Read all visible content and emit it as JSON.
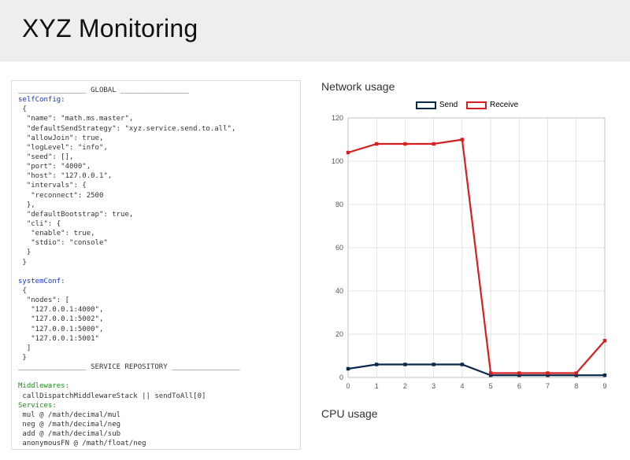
{
  "header": {
    "title": "XYZ Monitoring"
  },
  "config_panel": {
    "global_header": "________________ GLOBAL ________________",
    "selfConfig_label": "selfConfig:",
    "selfConfig_body": " {\n  \"name\": \"math.ms.master\",\n  \"defaultSendStrategy\": \"xyz.service.send.to.all\",\n  \"allowJoin\": true,\n  \"logLevel\": \"info\",\n  \"seed\": [],\n  \"port\": \"4000\",\n  \"host\": \"127.0.0.1\",\n  \"intervals\": {\n   \"reconnect\": 2500\n  },\n  \"defaultBootstrap\": true,\n  \"cli\": {\n   \"enable\": true,\n   \"stdio\": \"console\"\n  }\n }",
    "systemConf_label": "systemConf:",
    "systemConf_body": " {\n  \"nodes\": [\n   \"127.0.0.1:4000\",\n   \"127.0.0.1:5002\",\n   \"127.0.0.1:5000\",\n   \"127.0.0.1:5001\"\n  ]\n }",
    "repo_header": "________________ SERVICE REPOSITORY ________________",
    "middlewares_label": "Middlewares:",
    "middlewares_body": " callDispatchMiddlewareStack || sendToAll[0]",
    "services_label": "Services:",
    "services_body": " mul @ /math/decimal/mul\n neg @ /math/decimal/neg\n add @ /math/decimal/sub\n anonymousFN @ /math/float/neg"
  },
  "charts": {
    "network_title": "Network usage",
    "cpu_title": "CPU usage",
    "legend": {
      "send": "Send",
      "receive": "Receive"
    }
  },
  "colors": {
    "send": "#0a2a4a",
    "receive": "#d81f1f",
    "grid": "#cccccc",
    "axis": "#666666"
  },
  "chart_data": {
    "type": "line",
    "title": "Network usage",
    "xlabel": "",
    "ylabel": "",
    "x": [
      0,
      1,
      2,
      3,
      4,
      5,
      6,
      7,
      8,
      9
    ],
    "ylim": [
      0,
      120
    ],
    "y_ticks": [
      0,
      20,
      40,
      60,
      80,
      100,
      120
    ],
    "series": [
      {
        "name": "Send",
        "color": "#0a2a4a",
        "values": [
          4,
          6,
          6,
          6,
          6,
          1,
          1,
          1,
          1,
          1
        ]
      },
      {
        "name": "Receive",
        "color": "#d81f1f",
        "values": [
          104,
          108,
          108,
          108,
          110,
          2,
          2,
          2,
          2,
          17
        ]
      }
    ]
  }
}
